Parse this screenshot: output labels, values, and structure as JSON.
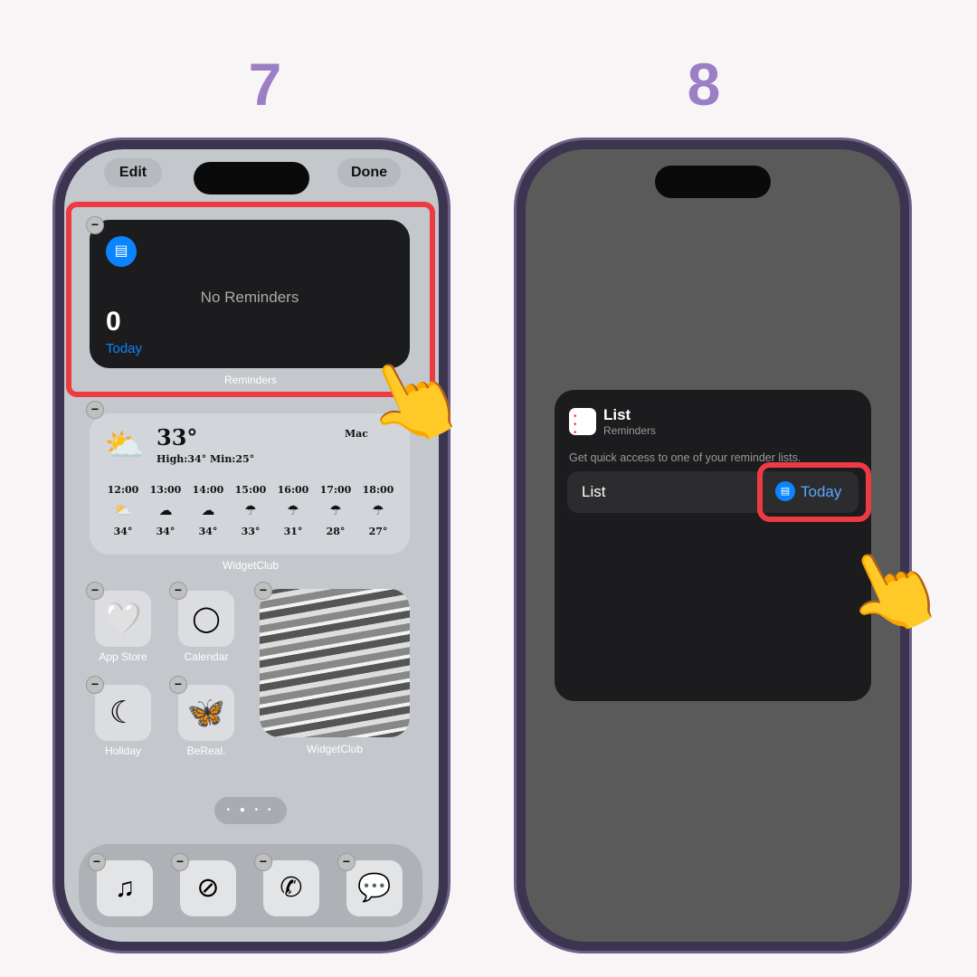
{
  "steps": [
    "7",
    "8"
  ],
  "left": {
    "edit_label": "Edit",
    "done_label": "Done",
    "reminders_widget": {
      "count": "0",
      "list": "Today",
      "empty": "No Reminders",
      "caption": "Reminders"
    },
    "weather_widget": {
      "temp": "33°",
      "hilo": "High:34° Min:25°",
      "location": "Mac",
      "caption": "WidgetClub",
      "hours": [
        {
          "time": "12:00",
          "icon": "partly-cloudy",
          "temp": "34°"
        },
        {
          "time": "13:00",
          "icon": "cloud",
          "temp": "34°"
        },
        {
          "time": "14:00",
          "icon": "cloud",
          "temp": "34°"
        },
        {
          "time": "15:00",
          "icon": "umbrella",
          "temp": "33°"
        },
        {
          "time": "16:00",
          "icon": "umbrella",
          "temp": "31°"
        },
        {
          "time": "17:00",
          "icon": "umbrella",
          "temp": "28°"
        },
        {
          "time": "18:00",
          "icon": "umbrella",
          "temp": "27°"
        }
      ]
    },
    "apps": [
      {
        "label": "App Store",
        "icon": "heart"
      },
      {
        "label": "Calendar",
        "icon": "ring"
      },
      {
        "label": "Holiday",
        "icon": "moon"
      },
      {
        "label": "BeReal.",
        "icon": "butterfly"
      }
    ],
    "photo_caption": "WidgetClub",
    "dock": [
      "music",
      "safari",
      "phone",
      "messages"
    ]
  },
  "right": {
    "title": "List",
    "subtitle": "Reminders",
    "description": "Get quick access to one of your reminder lists.",
    "row_label": "List",
    "row_value": "Today"
  },
  "colors": {
    "accent": "#9b7fc4",
    "highlight": "#ee3b43",
    "ios_blue": "#0a84ff"
  }
}
